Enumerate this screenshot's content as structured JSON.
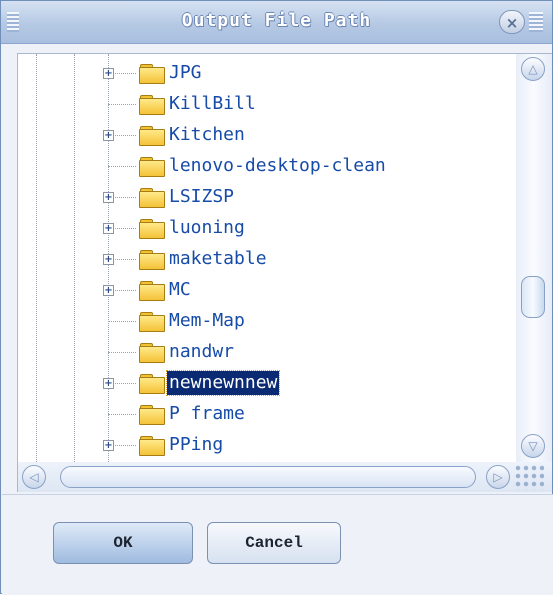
{
  "window": {
    "title": "Output File Path",
    "close_label": "×"
  },
  "tree": {
    "items": [
      {
        "label": "JPG",
        "expandable": true,
        "selected": false
      },
      {
        "label": "KillBill",
        "expandable": false,
        "selected": false
      },
      {
        "label": "Kitchen",
        "expandable": true,
        "selected": false
      },
      {
        "label": "lenovo-desktop-clean",
        "expandable": false,
        "selected": false
      },
      {
        "label": "LSIZSP",
        "expandable": true,
        "selected": false
      },
      {
        "label": "luoning",
        "expandable": true,
        "selected": false
      },
      {
        "label": "maketable",
        "expandable": true,
        "selected": false
      },
      {
        "label": "MC",
        "expandable": true,
        "selected": false
      },
      {
        "label": "Mem-Map",
        "expandable": false,
        "selected": false
      },
      {
        "label": "nandwr",
        "expandable": false,
        "selected": false
      },
      {
        "label": "newnewnnew",
        "expandable": true,
        "selected": true
      },
      {
        "label": "P frame",
        "expandable": false,
        "selected": false
      },
      {
        "label": "PPing",
        "expandable": true,
        "selected": false
      }
    ]
  },
  "scroll": {
    "vertical_position": 0.53,
    "up_arrow": "△",
    "down_arrow": "▽",
    "left_arrow": "◁",
    "right_arrow": "▷"
  },
  "buttons": {
    "ok": "OK",
    "cancel": "Cancel"
  }
}
